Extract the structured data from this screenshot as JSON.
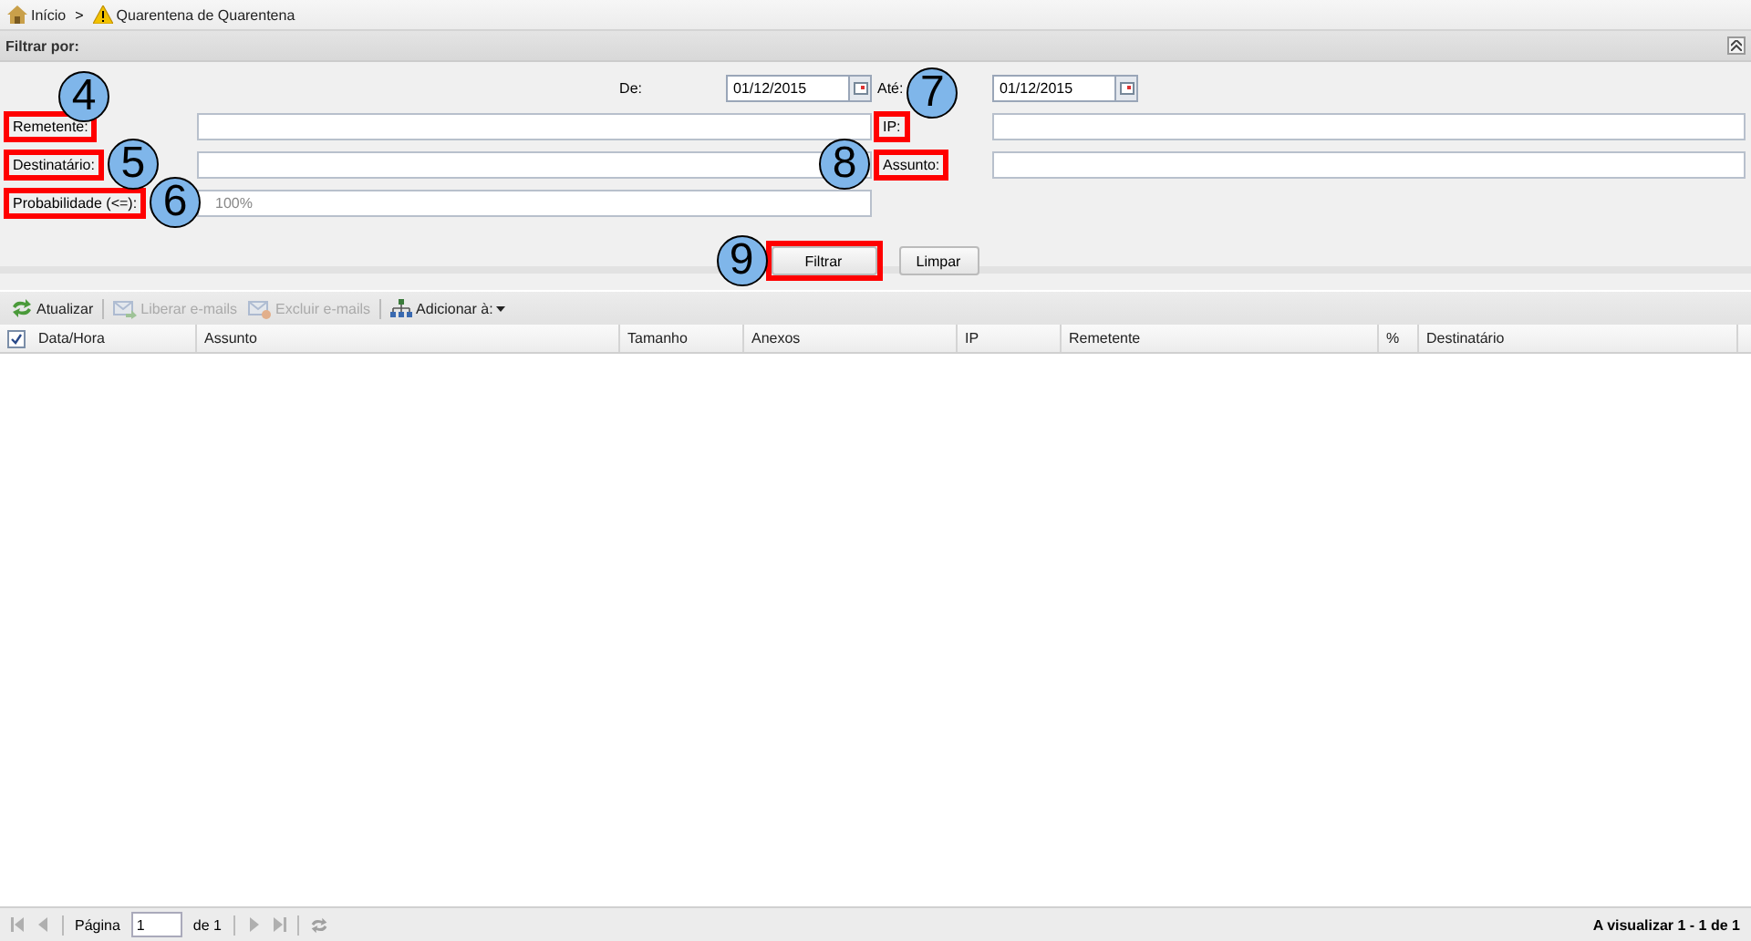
{
  "breadcrumb": [
    {
      "label": "Início"
    },
    {
      "label": "Quarentena de Quarentena"
    }
  ],
  "breadcrumb_separator": ">",
  "filter_panel": {
    "title": "Filtrar por:",
    "expanded": true,
    "date_from": {
      "label": "De:",
      "value": "01/12/2015"
    },
    "date_to": {
      "label": "Até:",
      "value": "01/12/2015",
      "callout": "7"
    },
    "left_fields": [
      {
        "label": "Remetente:",
        "highlighted": true,
        "callout": "4"
      },
      {
        "label": "Destinatário:",
        "highlighted": true,
        "callout": "5"
      },
      {
        "label": "Probabilidade (<=):",
        "highlighted": true,
        "placeholder": "100%",
        "callout": "6"
      }
    ],
    "right_fields": [
      {
        "label": "IP:",
        "highlighted": true
      },
      {
        "label": "Assunto:",
        "highlighted": true,
        "callout": "8"
      }
    ],
    "buttons": [
      {
        "label": "Filtrar",
        "highlighted": true,
        "callout": "9"
      },
      {
        "label": "Limpar",
        "highlighted": false
      }
    ]
  },
  "toolbar": [
    {
      "label": "Atualizar",
      "disabled": false
    },
    {
      "label": "Liberar e-mails",
      "disabled": true
    },
    {
      "label": "Excluir e-mails",
      "disabled": true
    },
    {
      "label": "Adicionar à:",
      "disabled": false,
      "dropdown": true
    }
  ],
  "table": {
    "select_all_checked": true,
    "columns": [
      "Data/Hora",
      "Assunto",
      "Tamanho",
      "Anexos",
      "IP",
      "Remetente",
      "%",
      "Destinatário"
    ]
  },
  "pager": {
    "page_label": "Página",
    "page": "1",
    "of_label": "de 1",
    "summary": "A visualizar 1 - 1 de 1"
  }
}
